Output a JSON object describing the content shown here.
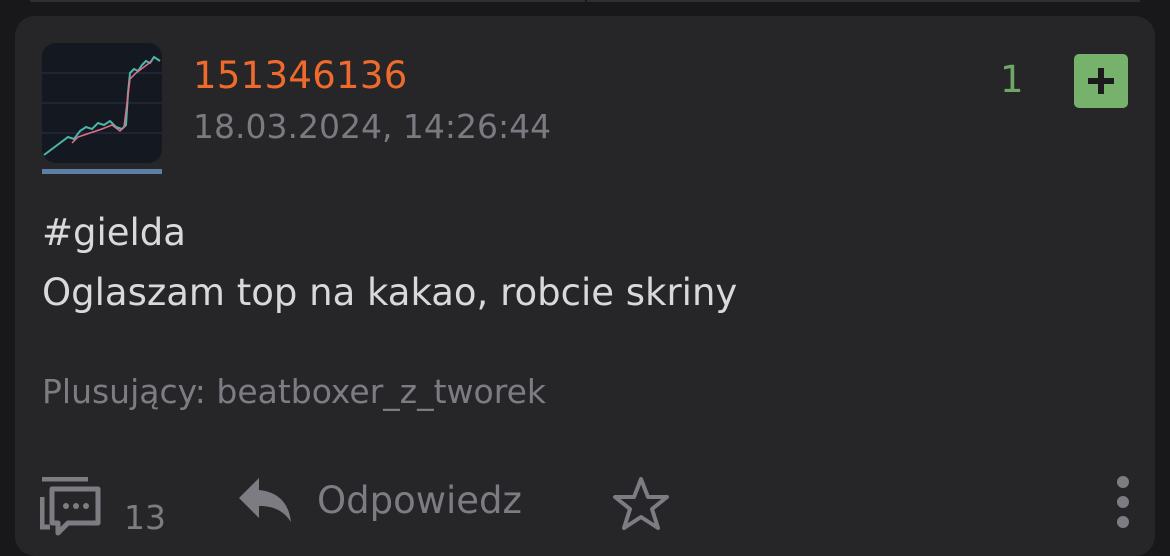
{
  "entry": {
    "author": "151346136",
    "date": "18.03.2024, 14:26:44",
    "score": "1",
    "tag": "#gielda",
    "text": "Oglaszam top na kakao, robcie skriny",
    "voters_label": "Plusujący:",
    "voters": "beatboxer_z_tworek"
  },
  "actions": {
    "comments_count": "13",
    "reply_label": "Odpowiedz"
  },
  "icons": {
    "vote": "plus-icon",
    "comments": "comments-icon",
    "reply": "reply-icon",
    "favorite": "star-icon",
    "more": "more-vertical-icon"
  },
  "colors": {
    "background": "#18181b",
    "card": "#262629",
    "author": "#f06a2c",
    "score": "#6fa866",
    "plus_button": "#77b26d",
    "avatar_underline": "#5b7fa6",
    "muted_text": "#7c7c82",
    "body_text": "#d9d9dc"
  }
}
